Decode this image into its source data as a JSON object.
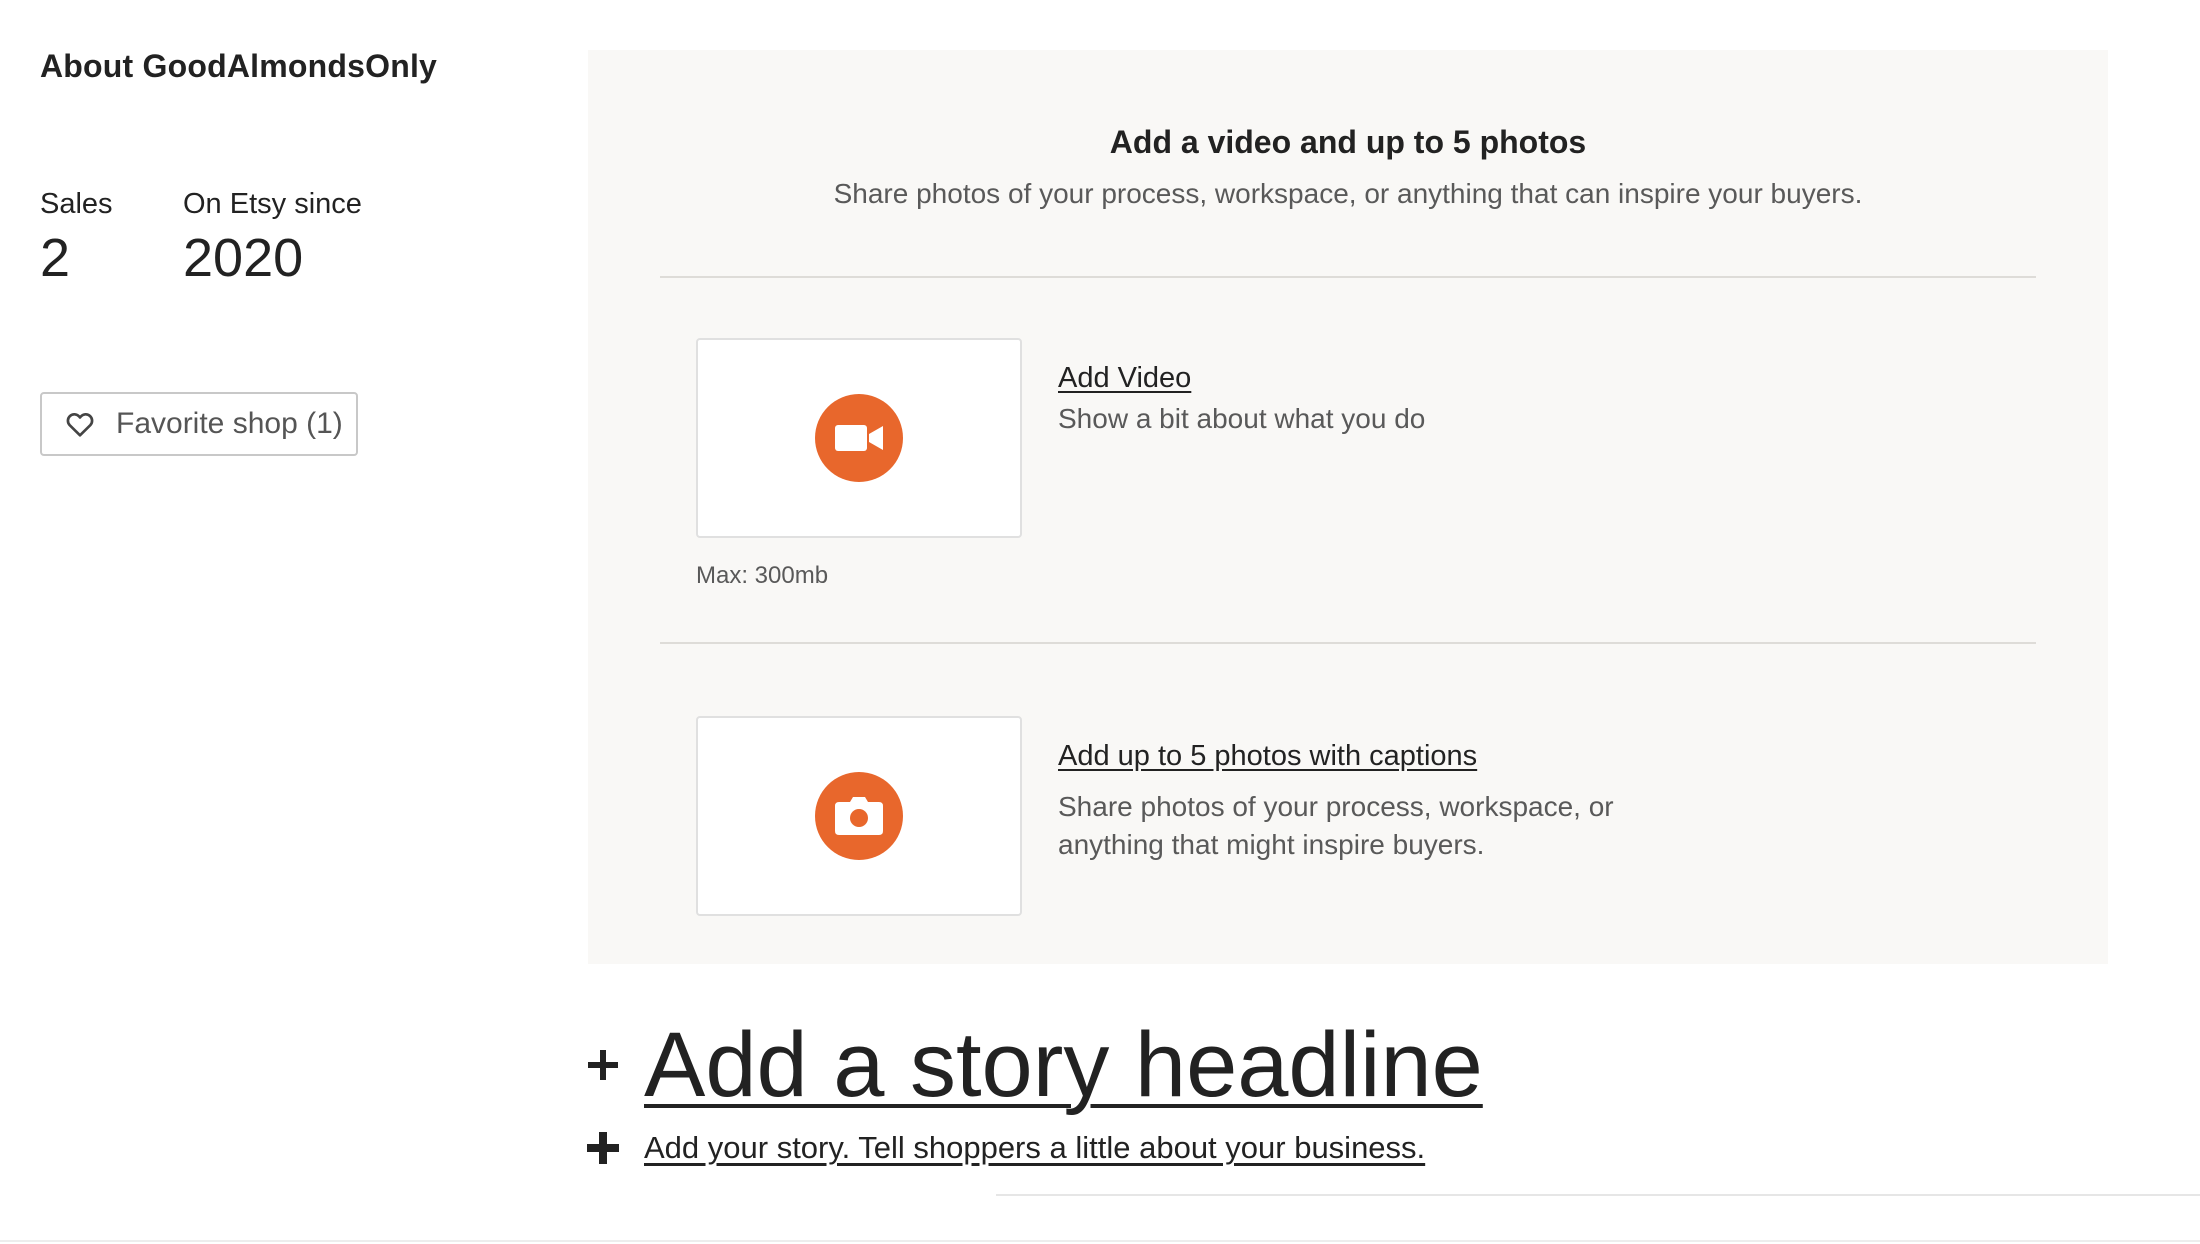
{
  "shop": {
    "about_title": "About GoodAlmondsOnly",
    "stats": {
      "sales_label": "Sales",
      "sales_value": "2",
      "since_label": "On Etsy since",
      "since_value": "2020"
    },
    "favorite_button": {
      "label": "Favorite shop (1)",
      "icon": "heart-icon"
    }
  },
  "media_panel": {
    "title": "Add a video and up to 5 photos",
    "subtitle": "Share photos of your process, workspace, or anything that can inspire your buyers.",
    "video": {
      "icon": "video-camera-icon",
      "link": "Add Video",
      "description": "Show a bit about what you do",
      "max_note": "Max: 300mb"
    },
    "photos": {
      "icon": "camera-icon",
      "link": "Add up to 5 photos with captions",
      "description": "Share photos of your process, workspace, or anything that might inspire buyers."
    }
  },
  "story": {
    "headline_link": "Add a story headline",
    "body_link": "Add your story. Tell shoppers a little about your business."
  },
  "colors": {
    "accent": "#e8672c",
    "panel_bg": "#f9f8f6",
    "text": "#222222",
    "muted_text": "#595959"
  }
}
